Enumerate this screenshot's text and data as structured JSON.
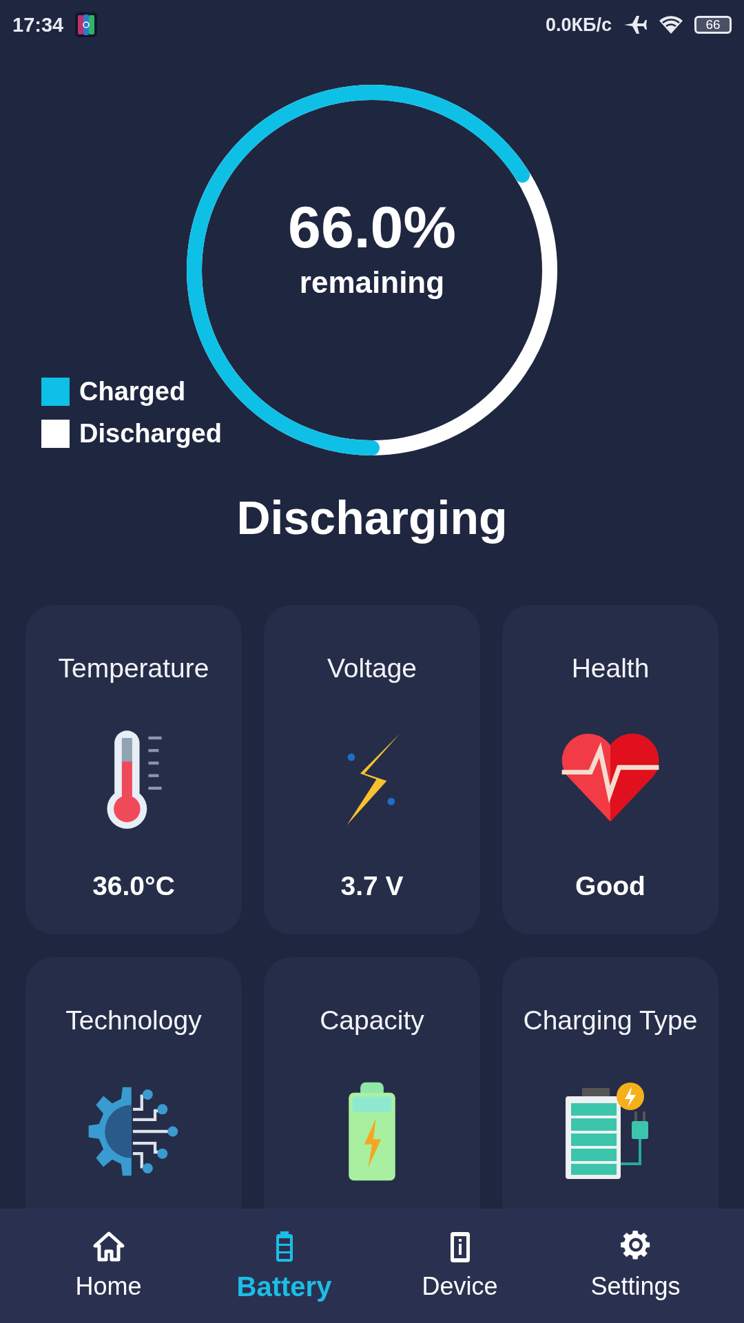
{
  "status_bar": {
    "time": "17:34",
    "network_speed": "0.0КБ/с",
    "battery": "66"
  },
  "gauge": {
    "level": 0.66,
    "value": "66.0%",
    "caption": "remaining"
  },
  "legend": [
    {
      "label": "Charged",
      "color": "#0fc0e6"
    },
    {
      "label": "Discharged",
      "color": "#ffffff"
    }
  ],
  "state": "Discharging",
  "cards": [
    {
      "title": "Temperature",
      "value": "36.0°C"
    },
    {
      "title": "Voltage",
      "value": "3.7 V"
    },
    {
      "title": "Health",
      "value": "Good"
    },
    {
      "title": "Technology"
    },
    {
      "title": "Capacity"
    },
    {
      "title": "Charging Type"
    }
  ],
  "nav": [
    {
      "label": "Home",
      "selected": false
    },
    {
      "label": "Battery",
      "selected": true
    },
    {
      "label": "Device",
      "selected": false
    },
    {
      "label": "Settings",
      "selected": false
    }
  ]
}
